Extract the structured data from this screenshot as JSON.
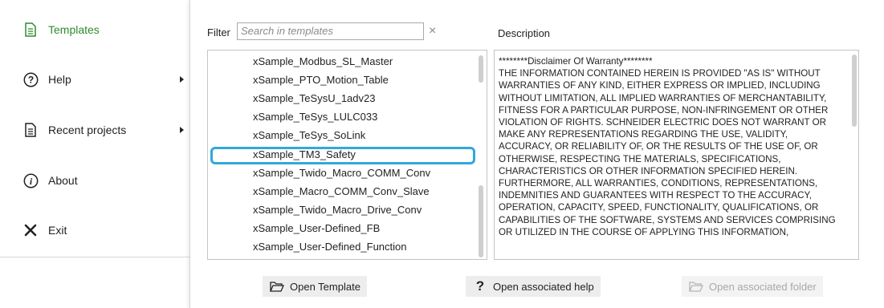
{
  "nav": {
    "items": [
      {
        "label": "Templates",
        "icon": "document-icon"
      },
      {
        "label": "Help",
        "icon": "help-circle-icon"
      },
      {
        "label": "Recent projects",
        "icon": "document-icon"
      },
      {
        "label": "About",
        "icon": "info-icon"
      },
      {
        "label": "Exit",
        "icon": "close-icon"
      }
    ]
  },
  "filter": {
    "label": "Filter",
    "placeholder": "Search in templates",
    "clear": "×"
  },
  "description": {
    "label": "Description",
    "text": "********Disclaimer Of Warranty********\nTHE INFORMATION CONTAINED HEREIN IS PROVIDED \"AS IS\" WITHOUT WARRANTIES OF ANY KIND, EITHER EXPRESS OR IMPLIED, INCLUDING WITHOUT LIMITATION, ALL IMPLIED WARRANTIES OF MERCHANTABILITY, FITNESS FOR A PARTICULAR PURPOSE, NON-INFRINGEMENT OR OTHER VIOLATION OF RIGHTS. SCHNEIDER ELECTRIC DOES NOT WARRANT OR MAKE ANY REPRESENTATIONS REGARDING THE USE, VALIDITY, ACCURACY, OR RELIABILITY OF, OR THE RESULTS OF THE USE OF, OR OTHERWISE, RESPECTING THE MATERIALS, SPECIFICATIONS, CHARACTERISTICS OR OTHER INFORMATION SPECIFIED HEREIN. FURTHERMORE, ALL WARRANTIES, CONDITIONS, REPRESENTATIONS, INDEMNITIES AND GUARANTEES WITH RESPECT TO THE ACCURACY, OPERATION, CAPACITY, SPEED, FUNCTIONALITY, QUALIFICATIONS, OR CAPABILITIES OF THE SOFTWARE, SYSTEMS AND SERVICES COMPRISING OR UTILIZED IN THE COURSE OF APPLYING THIS INFORMATION,"
  },
  "templates": [
    "xSample_Modbus_SL_Master",
    "xSample_PTO_Motion_Table",
    "xSample_TeSysU_1adv23",
    "xSample_TeSys_LULC033",
    "xSample_TeSys_SoLink",
    "xSample_TM3_Safety",
    "xSample_Twido_Macro_COMM_Conv",
    "xSample_Macro_COMM_Conv_Slave",
    "xSample_Twido_Macro_Drive_Conv",
    "xSample_User-Defined_FB",
    "xSample_User-Defined_Function"
  ],
  "selected_template": "xSample_TM3_Safety",
  "buttons": {
    "open_template": "Open Template",
    "open_help": "Open associated help",
    "open_folder": "Open associated folder"
  },
  "colors": {
    "accent_green": "#2e8b2e",
    "selection_blue": "#31a8dc"
  }
}
